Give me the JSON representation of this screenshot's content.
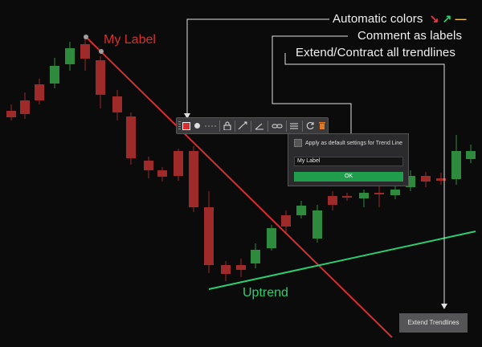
{
  "callouts": {
    "automatic_colors": "Automatic colors",
    "comment_as_labels": "Comment as labels",
    "extend_contract": "Extend/Contract all trendlines"
  },
  "callout_arrows": [
    {
      "glyph": "↘",
      "color": "#e63946"
    },
    {
      "glyph": "↗",
      "color": "#2ecc71"
    },
    {
      "glyph": "—",
      "color": "#f0c040"
    }
  ],
  "labels": {
    "my_label": "My Label",
    "uptrend": "Uptrend"
  },
  "colors": {
    "bull": "#2e8b3e",
    "bear": "#9e2a2a",
    "downtrend_line": "#d62f2f",
    "uptrend_line": "#2ecc71",
    "ok_button": "#1f9d4d"
  },
  "toolbar": {
    "items": [
      "color-swatch-icon",
      "circle-icon",
      "line-style-icon",
      "lock-icon",
      "extend-icon",
      "ruler-icon",
      "link-icon",
      "settings-icon",
      "refresh-icon",
      "trash-icon"
    ]
  },
  "popup": {
    "default_text": "Apply as default settings for Trend Line",
    "label_value": "My Label",
    "ok_label": "OK"
  },
  "extend_button": {
    "label": "Extend Trendlines"
  }
}
